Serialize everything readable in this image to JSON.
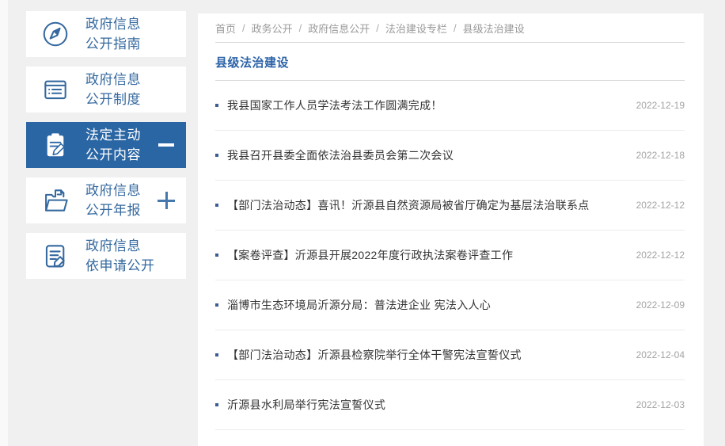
{
  "colors": {
    "page_bg": "#f0f0f1",
    "panel_bg": "#ffffff",
    "accent_blue": "#35699f",
    "active_item_bg": "#2b66a4",
    "active_item_text": "#ffffff",
    "title_blue": "#2d64a8",
    "article_text": "#333333",
    "date_gray": "#a3a3a3",
    "breadcrumb_gray": "#999999",
    "divider_strong": "#d9d9d9",
    "divider_light": "#ececec"
  },
  "sidebar": {
    "items": [
      {
        "lines": [
          "政府信息",
          "公开指南"
        ],
        "icon": "compass-icon",
        "active": false,
        "expander": "none"
      },
      {
        "lines": [
          "政府信息",
          "公开制度"
        ],
        "icon": "document-list-icon",
        "active": false,
        "expander": "none"
      },
      {
        "lines": [
          "法定主动",
          "公开内容"
        ],
        "icon": "clipboard-pen-icon",
        "active": true,
        "expander": "collapse"
      },
      {
        "lines": [
          "政府信息",
          "公开年报"
        ],
        "icon": "folder-document-icon",
        "active": false,
        "expander": "expand"
      },
      {
        "lines": [
          "政府信息",
          "依申请公开"
        ],
        "icon": "document-pen-icon",
        "active": false,
        "expander": "none"
      }
    ]
  },
  "breadcrumb": {
    "separator": "/",
    "items": [
      "首页",
      "政务公开",
      "政府信息公开",
      "法治建设专栏",
      "县级法治建设"
    ]
  },
  "main": {
    "title": "县级法治建设",
    "articles": [
      {
        "title": "我县国家工作人员学法考法工作圆满完成！",
        "date": "2022-12-19"
      },
      {
        "title": "我县召开县委全面依法治县委员会第二次会议",
        "date": "2022-12-18"
      },
      {
        "title": "【部门法治动态】喜讯！沂源县自然资源局被省厅确定为基层法治联系点",
        "date": "2022-12-12"
      },
      {
        "title": "【案卷评查】沂源县开展2022年度行政执法案卷评查工作",
        "date": "2022-12-12"
      },
      {
        "title": "淄博市生态环境局沂源分局：普法进企业 宪法入人心",
        "date": "2022-12-09"
      },
      {
        "title": "【部门法治动态】沂源县检察院举行全体干警宪法宣誓仪式",
        "date": "2022-12-04"
      },
      {
        "title": "沂源县水利局举行宪法宣誓仪式",
        "date": "2022-12-03"
      }
    ]
  }
}
